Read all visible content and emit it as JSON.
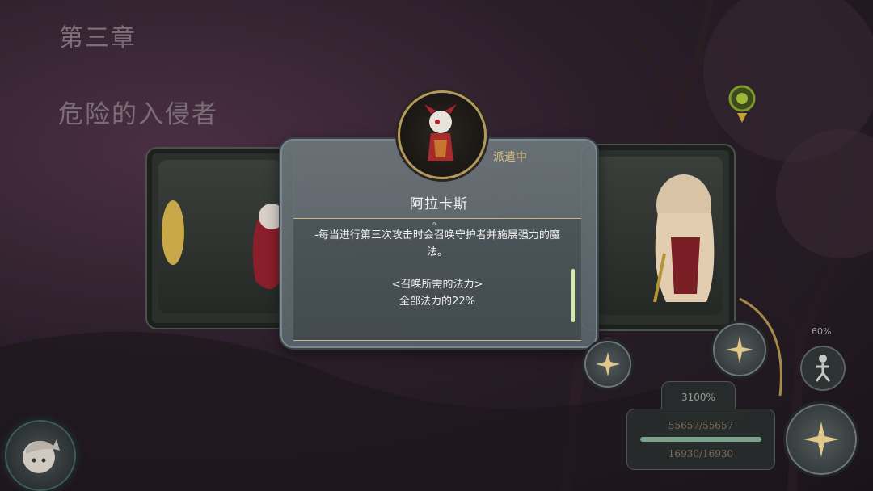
{
  "chapter": "第三章",
  "stage_title": "危险的入侵者",
  "hero": {
    "name": "阿拉卡斯",
    "status": "派遣中",
    "desc_mark": "。",
    "desc_line1": "-每当进行第三次攻击时会召唤守护者并施展强力的魔法。",
    "mana_header": "<召唤所需的法力>",
    "mana_value": "全部法力的22%"
  },
  "stats": {
    "multiplier": "3100%",
    "hp": "55657/55657",
    "mp": "16930/16930",
    "hp_fraction": 1.0
  },
  "controls": {
    "dash_percent": "60%"
  },
  "icons": {
    "skill": "crossed-blades-icon",
    "dash": "dash-runner-icon",
    "map_pin": "map-pin-icon"
  },
  "colors": {
    "accent_gold": "#d9c07e",
    "hp_bar": "#7aa28a",
    "scroll_indicator": "#d6e9a8"
  }
}
